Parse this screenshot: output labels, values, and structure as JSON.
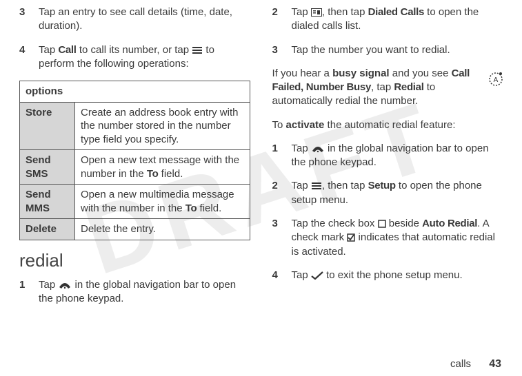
{
  "watermark": "DRAFT",
  "left": {
    "step3": {
      "num": "3",
      "text_a": "Tap an entry to see call details (time, date, duration)."
    },
    "step4": {
      "num": "4",
      "text_a": "Tap ",
      "call": "Call",
      "text_b": " to call its number, or tap ",
      "text_c": " to perform the following operations:"
    },
    "table": {
      "header": "options",
      "rows": [
        {
          "label": "Store",
          "desc_a": "Create an address book entry with the number stored in the number type field you specify."
        },
        {
          "label": "Send SMS",
          "desc_a": "Open a new text message with the number in the ",
          "to": "To",
          "desc_b": " field."
        },
        {
          "label": "Send MMS",
          "desc_a": "Open a new multimedia message with the number in the ",
          "to": "To",
          "desc_b": " field."
        },
        {
          "label": "Delete",
          "desc_a": "Delete the entry."
        }
      ]
    },
    "heading": "redial",
    "step1": {
      "num": "1",
      "text_a": "Tap ",
      "text_b": " in the global navigation bar to open the phone keypad."
    }
  },
  "right": {
    "step2": {
      "num": "2",
      "text_a": "Tap ",
      "text_b": ", then tap ",
      "dialed": "Dialed Calls",
      "text_c": " to open the dialed calls list."
    },
    "step3": {
      "num": "3",
      "text_a": "Tap the number you want to redial."
    },
    "busy": {
      "text_a": "If you hear a ",
      "busy_signal": "busy signal",
      "text_b": " and you see ",
      "call_failed": "Call Failed, Number Busy",
      "text_c": ", tap ",
      "redial": "Redial",
      "text_d": " to automatically redial the number."
    },
    "activate": {
      "text_a": "To ",
      "activate": "activate",
      "text_b": " the automatic redial feature:"
    },
    "a_step1": {
      "num": "1",
      "text_a": "Tap ",
      "text_b": " in the global navigation bar to open the phone keypad."
    },
    "a_step2": {
      "num": "2",
      "text_a": "Tap ",
      "text_b": ", then tap ",
      "setup": "Setup",
      "text_c": " to open the phone setup menu."
    },
    "a_step3": {
      "num": "3",
      "text_a": "Tap the check box ",
      "text_b": " beside ",
      "auto_redial": "Auto Redial",
      "text_c": ". A check mark ",
      "text_d": " indicates that automatic redial is activated."
    },
    "a_step4": {
      "num": "4",
      "text_a": "Tap ",
      "text_b": " to exit the phone setup menu."
    }
  },
  "footer": {
    "label": "calls",
    "page": "43"
  }
}
